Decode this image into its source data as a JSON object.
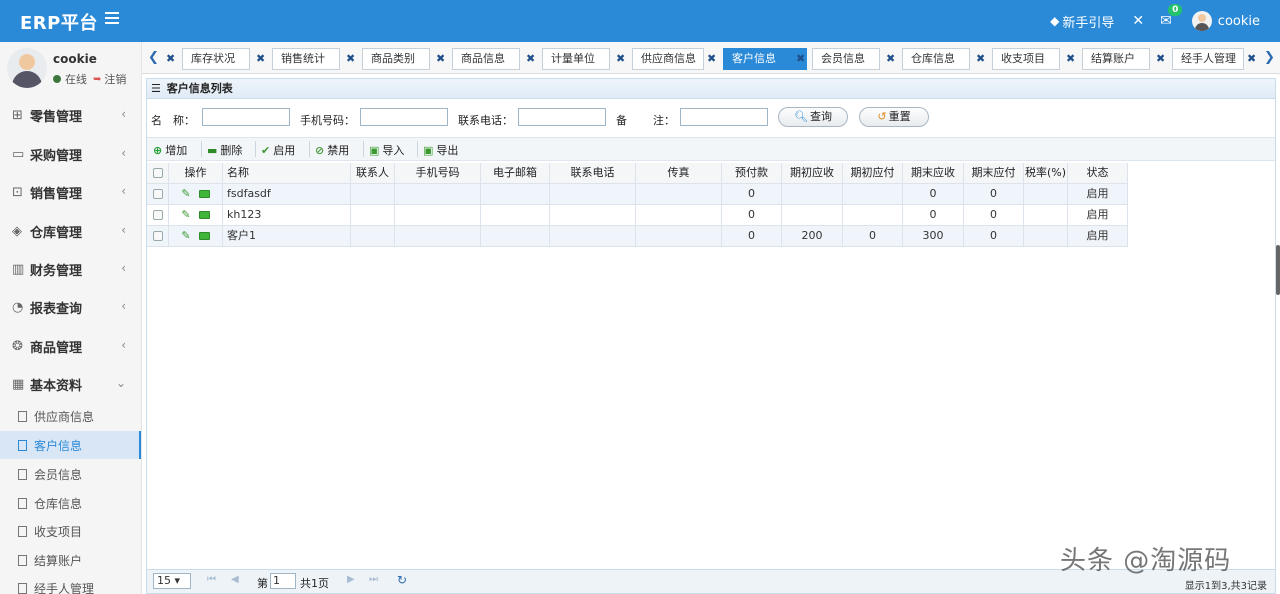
{
  "header": {
    "brand": "ERP平台",
    "guide_label": "新手引导",
    "mail_badge": "0",
    "username": "cookie"
  },
  "sidebar": {
    "username": "cookie",
    "status": "在线",
    "logout": "注销",
    "menus": [
      {
        "label": "零售管理",
        "icon": "gift-icon"
      },
      {
        "label": "采购管理",
        "icon": "cart-icon"
      },
      {
        "label": "销售管理",
        "icon": "briefcase-icon"
      },
      {
        "label": "仓库管理",
        "icon": "layers-icon"
      },
      {
        "label": "财务管理",
        "icon": "book-icon"
      },
      {
        "label": "报表查询",
        "icon": "pie-icon"
      },
      {
        "label": "商品管理",
        "icon": "box-icon"
      },
      {
        "label": "基本资料",
        "icon": "grid-icon"
      }
    ],
    "sub_items": [
      "供应商信息",
      "客户信息",
      "会员信息",
      "仓库信息",
      "收支项目",
      "结算账户",
      "经手人管理"
    ],
    "active_sub": "客户信息"
  },
  "tabs": [
    "库存状况",
    "销售统计",
    "商品类别",
    "商品信息",
    "计量单位",
    "供应商信息",
    "客户信息",
    "会员信息",
    "仓库信息",
    "收支项目",
    "结算账户",
    "经手人管理"
  ],
  "active_tab": "客户信息",
  "panel": {
    "title": "客户信息列表"
  },
  "search": {
    "name_label": "名　称：",
    "phone_label": "手机号码：",
    "tel_label": "联系电话：",
    "remark_label_1": "备",
    "remark_label_2": "注：",
    "query_button": "查询",
    "reset_button": "重置"
  },
  "toolbar": {
    "add": "增加",
    "delete": "删除",
    "enable": "启用",
    "disable": "禁用",
    "import": "导入",
    "export": "导出"
  },
  "table": {
    "columns": [
      "",
      "操作",
      "名称",
      "联系人",
      "手机号码",
      "电子邮箱",
      "联系电话",
      "传真",
      "预付款",
      "期初应收",
      "期初应付",
      "期末应收",
      "期末应付",
      "税率(%)",
      "状态"
    ],
    "rows": [
      {
        "name": "fsdfasdf",
        "contact": "",
        "mobile": "",
        "email": "",
        "tel": "",
        "fax": "",
        "prepay": "0",
        "init_recv": "",
        "init_pay": "",
        "end_recv": "0",
        "end_pay": "0",
        "tax": "",
        "status": "启用"
      },
      {
        "name": "kh123",
        "contact": "",
        "mobile": "",
        "email": "",
        "tel": "",
        "fax": "",
        "prepay": "0",
        "init_recv": "",
        "init_pay": "",
        "end_recv": "0",
        "end_pay": "0",
        "tax": "",
        "status": "启用"
      },
      {
        "name": "客户1",
        "contact": "",
        "mobile": "",
        "email": "",
        "tel": "",
        "fax": "",
        "prepay": "0",
        "init_recv": "200",
        "init_pay": "0",
        "end_recv": "300",
        "end_pay": "0",
        "tax": "",
        "status": "启用"
      }
    ]
  },
  "pager": {
    "page_size": "15",
    "page_label_pre": "第",
    "page_value": "1",
    "page_label_post": "共1页",
    "info": "显示1到3,共3记录"
  },
  "watermark": "头条 @淘源码",
  "colors": {
    "accent": "#2b8ad8",
    "row_bg": "#f0f5fb"
  }
}
